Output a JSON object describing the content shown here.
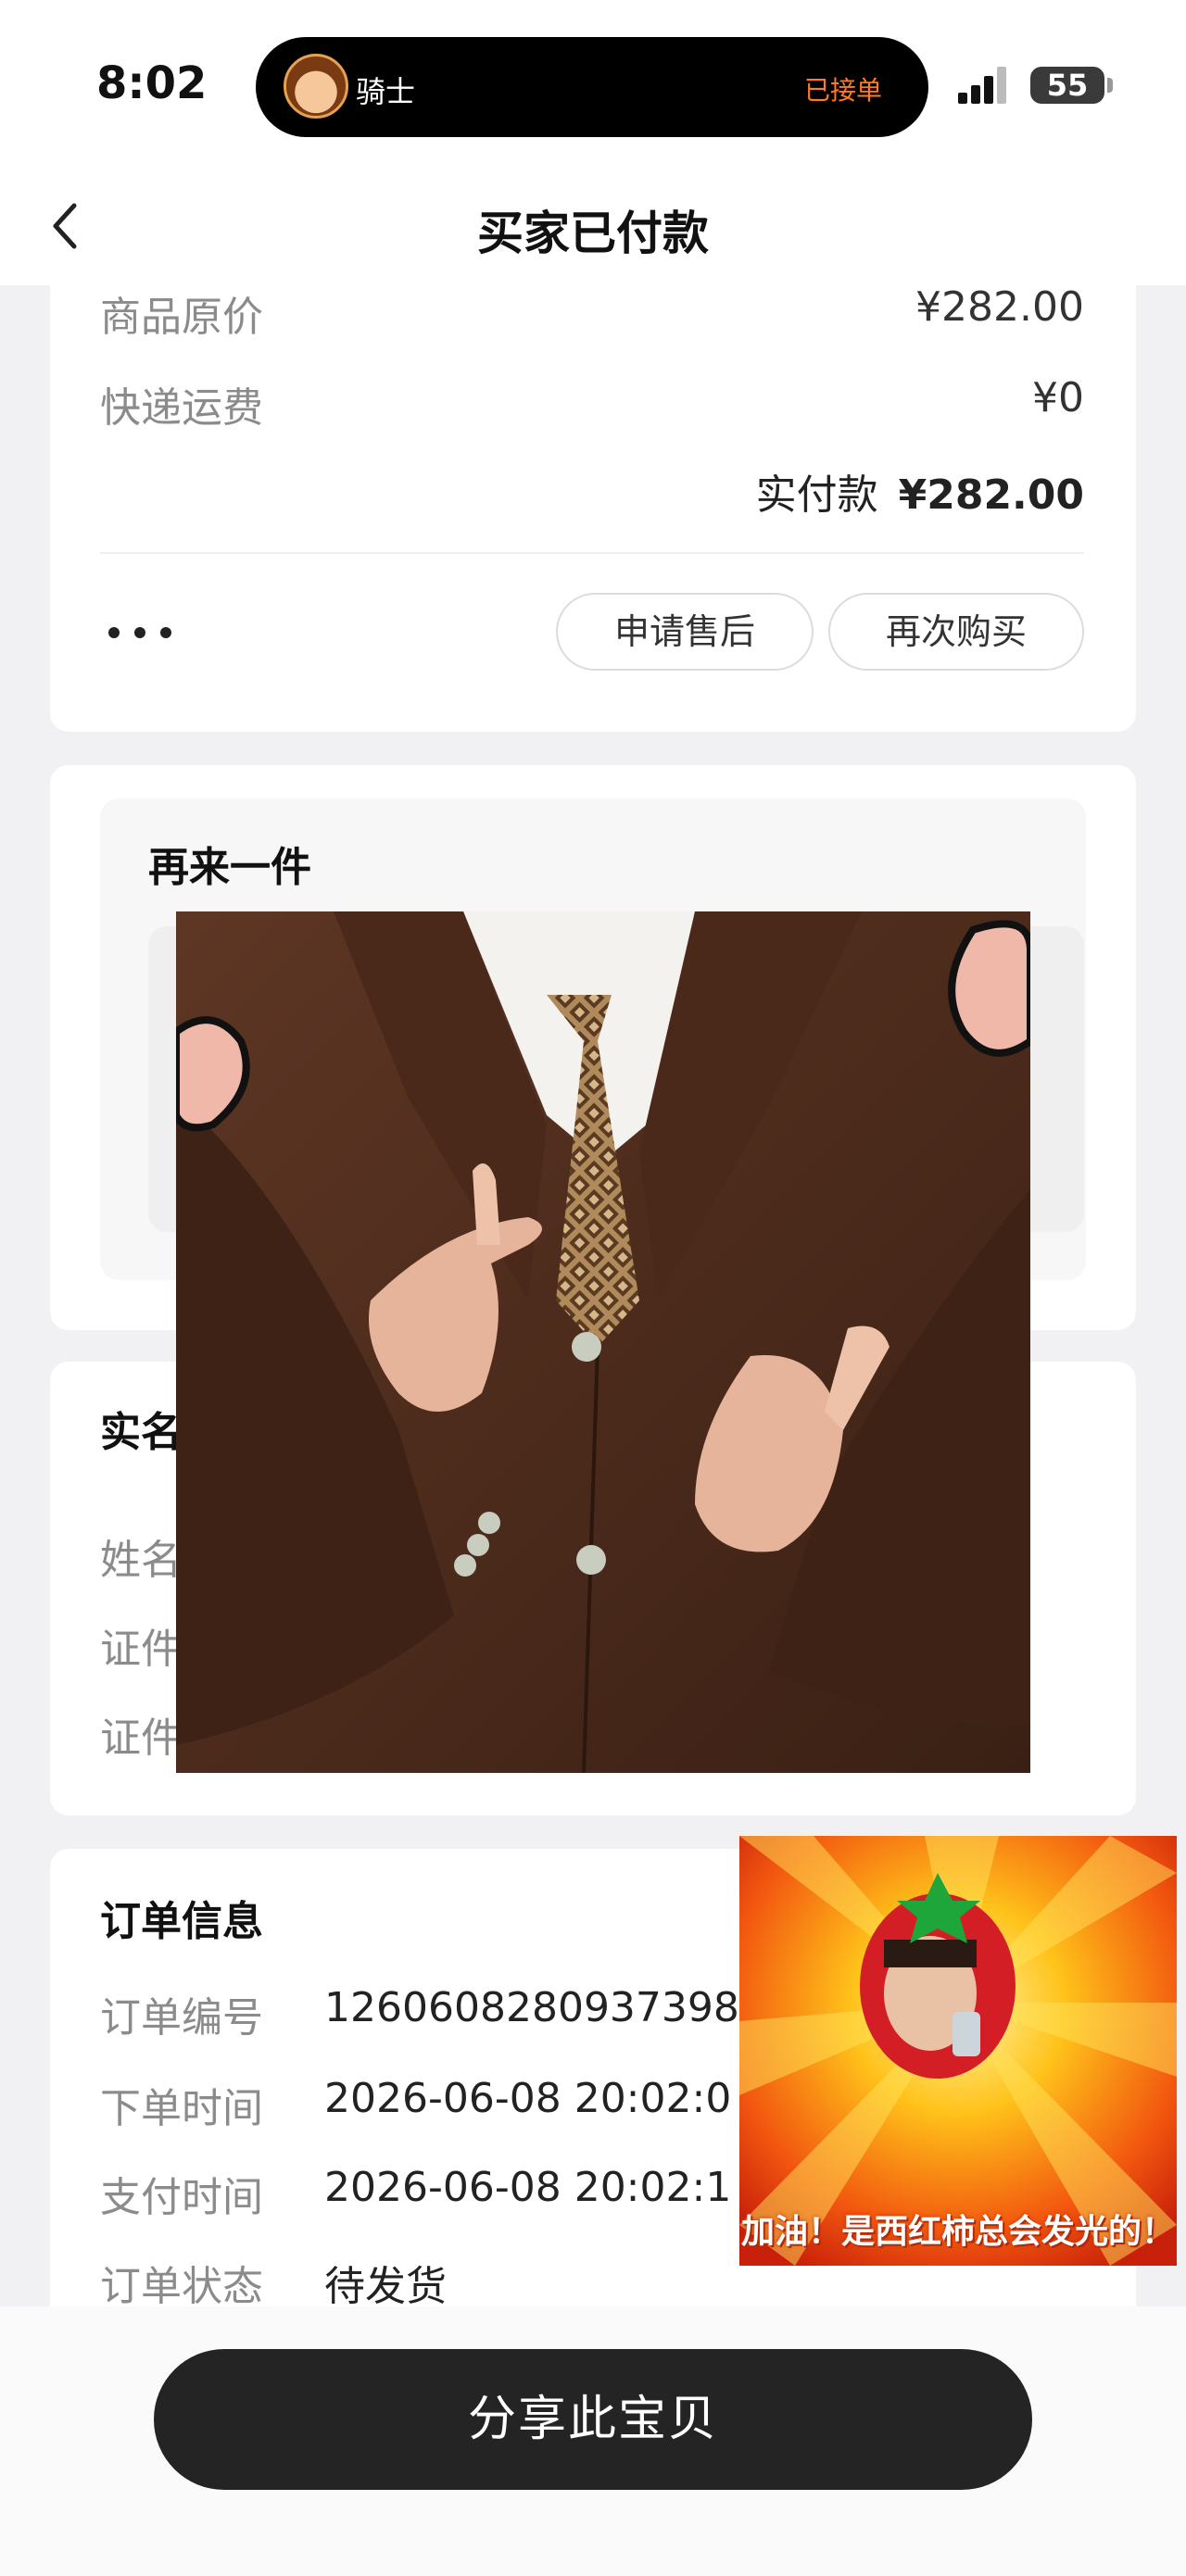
{
  "status_bar": {
    "time": "8:02",
    "island_name": "骑士",
    "island_status": "已接单",
    "battery": "55"
  },
  "nav": {
    "title": "买家已付款"
  },
  "price_card": {
    "rows": [
      {
        "label": "商品原价",
        "value": "¥282.00"
      },
      {
        "label": "快递运费",
        "value": "¥0"
      }
    ],
    "total_label": "实付款",
    "total_value": "¥282.00",
    "buttons": {
      "after_sale": "申请售后",
      "buy_again": "再次购买"
    }
  },
  "again_card": {
    "title": "再来一件"
  },
  "realname_card": {
    "title_visible": "实名",
    "labels_visible": [
      "姓名",
      "证件",
      "证件"
    ]
  },
  "order_card": {
    "title": "订单信息",
    "rows": [
      {
        "label": "订单编号",
        "value": "1260608280937398"
      },
      {
        "label": "下单时间",
        "value": "2026-06-08 20:02:0"
      },
      {
        "label": "支付时间",
        "value": "2026-06-08 20:02:1"
      },
      {
        "label": "订单状态",
        "value": "待发货"
      }
    ]
  },
  "sticker": {
    "caption": "加油！是西红柿总会发光的！"
  },
  "bottom": {
    "share_label": "分享此宝贝"
  },
  "colors": {
    "accent_orange": "#ff7a21",
    "button_dark": "#242424",
    "page_bg": "#f1f1f4"
  },
  "icons": [
    "back-arrow-icon",
    "more-dots-icon",
    "signal-icon",
    "battery-icon"
  ]
}
